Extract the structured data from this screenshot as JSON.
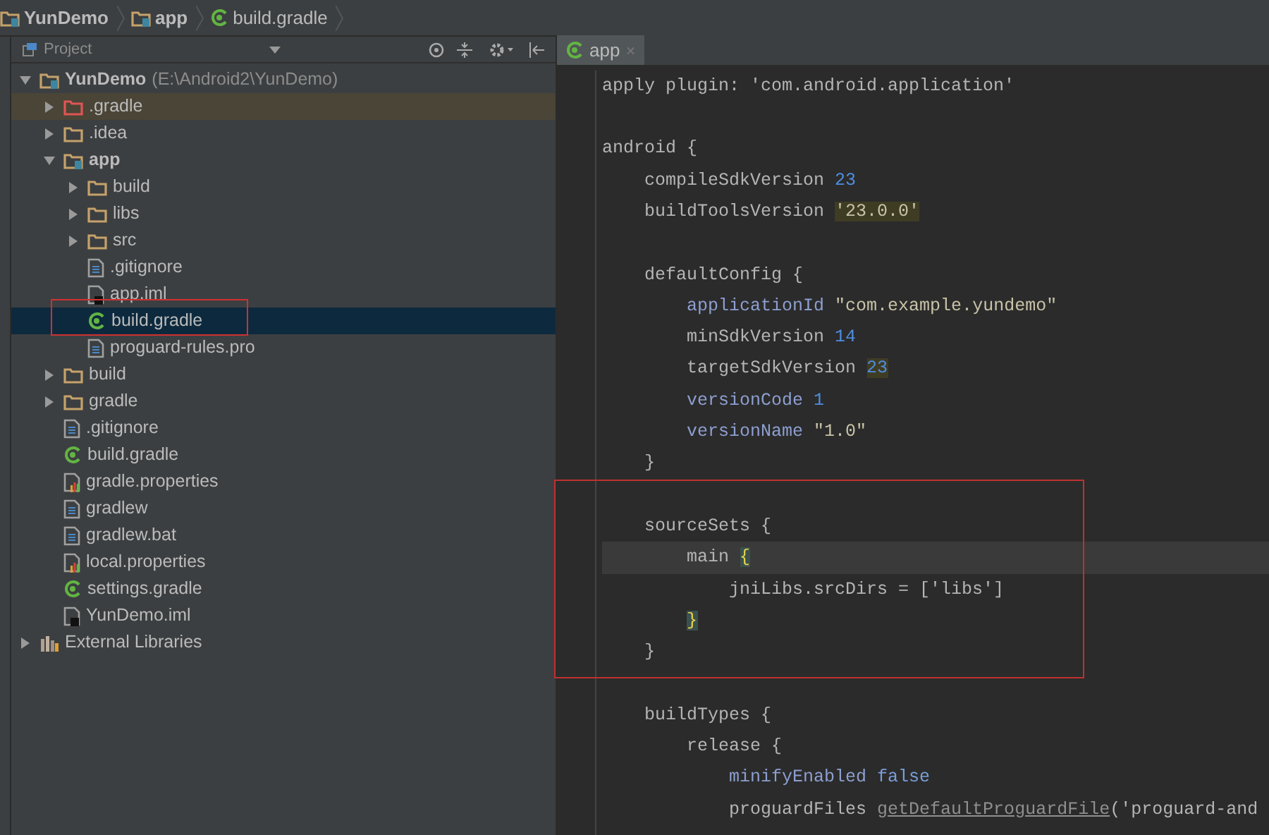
{
  "breadcrumbs": [
    {
      "label": "YunDemo",
      "kind": "project"
    },
    {
      "label": "app",
      "kind": "module"
    },
    {
      "label": "build.gradle",
      "kind": "gradle"
    }
  ],
  "project_panel": {
    "title": "Project",
    "tree": [
      {
        "label": "YunDemo",
        "path": "(E:\\Android2\\YunDemo)",
        "kind": "project",
        "expanded": true,
        "selected": false,
        "children": [
          {
            "label": ".gradle",
            "kind": "excluded_folder",
            "expanded": false,
            "selected": false,
            "hovered": true
          },
          {
            "label": ".idea",
            "kind": "folder",
            "expanded": false,
            "selected": false
          },
          {
            "label": "app",
            "kind": "module",
            "expanded": true,
            "selected": false,
            "children": [
              {
                "label": "build",
                "kind": "folder",
                "expanded": false,
                "selected": false
              },
              {
                "label": "libs",
                "kind": "folder",
                "expanded": false,
                "selected": false
              },
              {
                "label": "src",
                "kind": "folder",
                "expanded": false,
                "selected": false
              },
              {
                "label": ".gitignore",
                "kind": "file",
                "selected": false
              },
              {
                "label": "app.iml",
                "kind": "iml",
                "selected": false
              },
              {
                "label": "build.gradle",
                "kind": "gradle",
                "selected": true
              },
              {
                "label": "proguard-rules.pro",
                "kind": "file",
                "selected": false
              }
            ]
          },
          {
            "label": "build",
            "kind": "folder",
            "expanded": false,
            "selected": false
          },
          {
            "label": "gradle",
            "kind": "folder",
            "expanded": false,
            "selected": false
          },
          {
            "label": ".gitignore",
            "kind": "file",
            "selected": false
          },
          {
            "label": "build.gradle",
            "kind": "gradle",
            "selected": false
          },
          {
            "label": "gradle.properties",
            "kind": "properties",
            "selected": false
          },
          {
            "label": "gradlew",
            "kind": "file",
            "selected": false
          },
          {
            "label": "gradlew.bat",
            "kind": "file",
            "selected": false
          },
          {
            "label": "local.properties",
            "kind": "properties",
            "selected": false
          },
          {
            "label": "settings.gradle",
            "kind": "gradle",
            "selected": false
          },
          {
            "label": "YunDemo.iml",
            "kind": "iml",
            "selected": false
          }
        ]
      },
      {
        "label": "External Libraries",
        "kind": "libraries",
        "expanded": false,
        "selected": false
      }
    ]
  },
  "editor": {
    "tabs": [
      {
        "label": "app",
        "close": "×",
        "selected": true
      }
    ],
    "lines": [
      {
        "current": false,
        "segments": [
          {
            "text": "apply plugin: 'com.android.application'",
            "kind": "plain"
          }
        ]
      },
      {
        "current": false
      },
      {
        "current": false,
        "segments": [
          {
            "text": "android {",
            "kind": "plain"
          }
        ]
      },
      {
        "current": false,
        "segments": [
          {
            "text": "    compileSdkVersion ",
            "kind": "plain"
          },
          {
            "text": "23",
            "kind": "number"
          }
        ]
      },
      {
        "current": false,
        "segments": [
          {
            "text": "    buildToolsVersion ",
            "kind": "plain"
          },
          {
            "text": "'23.0.0'",
            "kind": "string",
            "marked": true
          }
        ]
      },
      {
        "current": false
      },
      {
        "current": false,
        "segments": [
          {
            "text": "    defaultConfig {",
            "kind": "plain"
          }
        ]
      },
      {
        "current": false,
        "segments": [
          {
            "text": "        applicationId ",
            "kind": "property"
          },
          {
            "text": "\"com.example.yundemo\"",
            "kind": "string"
          }
        ]
      },
      {
        "current": false,
        "segments": [
          {
            "text": "        minSdkVersion ",
            "kind": "plain"
          },
          {
            "text": "14",
            "kind": "number"
          }
        ]
      },
      {
        "current": false,
        "segments": [
          {
            "text": "        targetSdkVersion ",
            "kind": "plain"
          },
          {
            "text": "23",
            "kind": "number",
            "marked": true
          }
        ]
      },
      {
        "current": false,
        "segments": [
          {
            "text": "        versionCode ",
            "kind": "property"
          },
          {
            "text": "1",
            "kind": "number"
          }
        ]
      },
      {
        "current": false,
        "segments": [
          {
            "text": "        versionName ",
            "kind": "property"
          },
          {
            "text": "\"1.0\"",
            "kind": "string"
          }
        ]
      },
      {
        "current": false,
        "segments": [
          {
            "text": "    }",
            "kind": "plain"
          }
        ]
      },
      {
        "current": false
      },
      {
        "current": false,
        "segments": [
          {
            "text": "    sourceSets {",
            "kind": "plain"
          }
        ]
      },
      {
        "current": true,
        "segments": [
          {
            "text": "        main ",
            "kind": "plain"
          },
          {
            "text": "{",
            "kind": "brace_match"
          }
        ]
      },
      {
        "current": false,
        "segments": [
          {
            "text": "            jniLibs.srcDirs = ['libs']",
            "kind": "plain"
          }
        ]
      },
      {
        "current": false,
        "segments": [
          {
            "text": "        }",
            "kind": "brace_match"
          }
        ]
      },
      {
        "current": false,
        "segments": [
          {
            "text": "    }",
            "kind": "plain"
          }
        ]
      },
      {
        "current": false
      },
      {
        "current": false,
        "segments": [
          {
            "text": "    buildTypes {",
            "kind": "plain"
          }
        ]
      },
      {
        "current": false,
        "segments": [
          {
            "text": "        release {",
            "kind": "plain"
          }
        ]
      },
      {
        "current": false,
        "segments": [
          {
            "text": "            minifyEnabled ",
            "kind": "property"
          },
          {
            "text": "false",
            "kind": "keyword"
          }
        ]
      },
      {
        "current": false,
        "segments": [
          {
            "text": "            proguardFiles ",
            "kind": "plain"
          },
          {
            "text": "getDefaultProguardFile",
            "kind": "method"
          },
          {
            "text": "('proguard-and",
            "kind": "plain"
          }
        ]
      }
    ]
  }
}
